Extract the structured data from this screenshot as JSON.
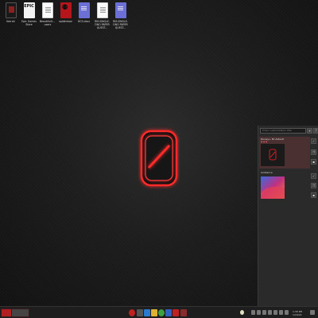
{
  "desktop_icons": [
    {
      "label": "Kerrah",
      "kind": "kerrah"
    },
    {
      "label": "Epic Games Store",
      "kind": "epic",
      "badge": "EPIC"
    },
    {
      "label": "BeautifulS... .users",
      "kind": "doc"
    },
    {
      "label": "spiderman",
      "kind": "spider"
    },
    {
      "label": "DCS.docx",
      "kind": "blue"
    },
    {
      "label": "RM-SINGLE-DNO PAPER QUEST...",
      "kind": "doc"
    },
    {
      "label": "RM-SINGLE-DNO PAPER QUEST...",
      "kind": "blue"
    }
  ],
  "panel": {
    "search_placeholder": "Enter customization title",
    "cards": [
      {
        "title": "Disney+ Ek default",
        "subtitle": "● ● ●",
        "selected": true
      },
      {
        "title": "ambience",
        "subtitle": "",
        "selected": false
      }
    ]
  },
  "taskbar": {
    "time": "1:38 PM",
    "date": "1/18/22"
  },
  "colors": {
    "accent": "#ff2a2a",
    "panel_bg": "#2a2a2a",
    "selected_card": "#4a3030"
  }
}
